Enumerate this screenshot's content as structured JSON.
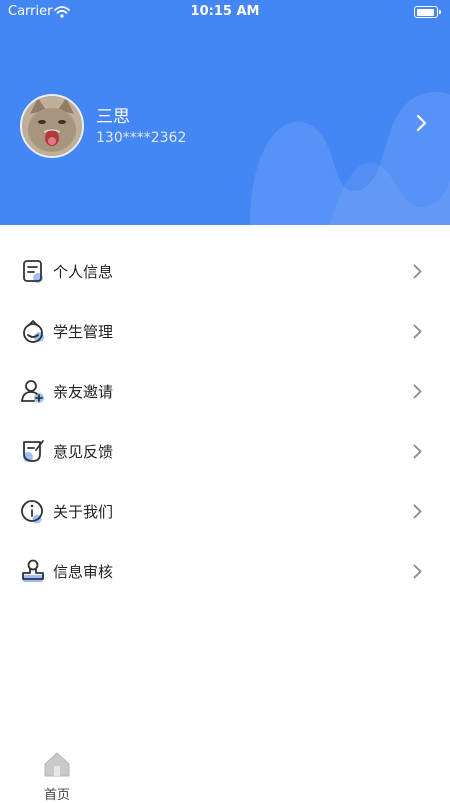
{
  "status_bar": {
    "carrier": "Carrier",
    "time": "10:15 AM"
  },
  "profile": {
    "name": "三思",
    "phone": "130****2362"
  },
  "menu": [
    {
      "label": "个人信息",
      "icon": "person-card-icon"
    },
    {
      "label": "学生管理",
      "icon": "student-icon"
    },
    {
      "label": "亲友邀请",
      "icon": "invite-friend-icon"
    },
    {
      "label": "意见反馈",
      "icon": "feedback-icon"
    },
    {
      "label": "关于我们",
      "icon": "info-icon"
    },
    {
      "label": "信息审核",
      "icon": "stamp-icon"
    }
  ],
  "tabbar": {
    "home_label": "首页"
  },
  "colors": {
    "header": "#4586f5",
    "icon_stroke": "#333333",
    "icon_accent": "#9ec0fa"
  }
}
